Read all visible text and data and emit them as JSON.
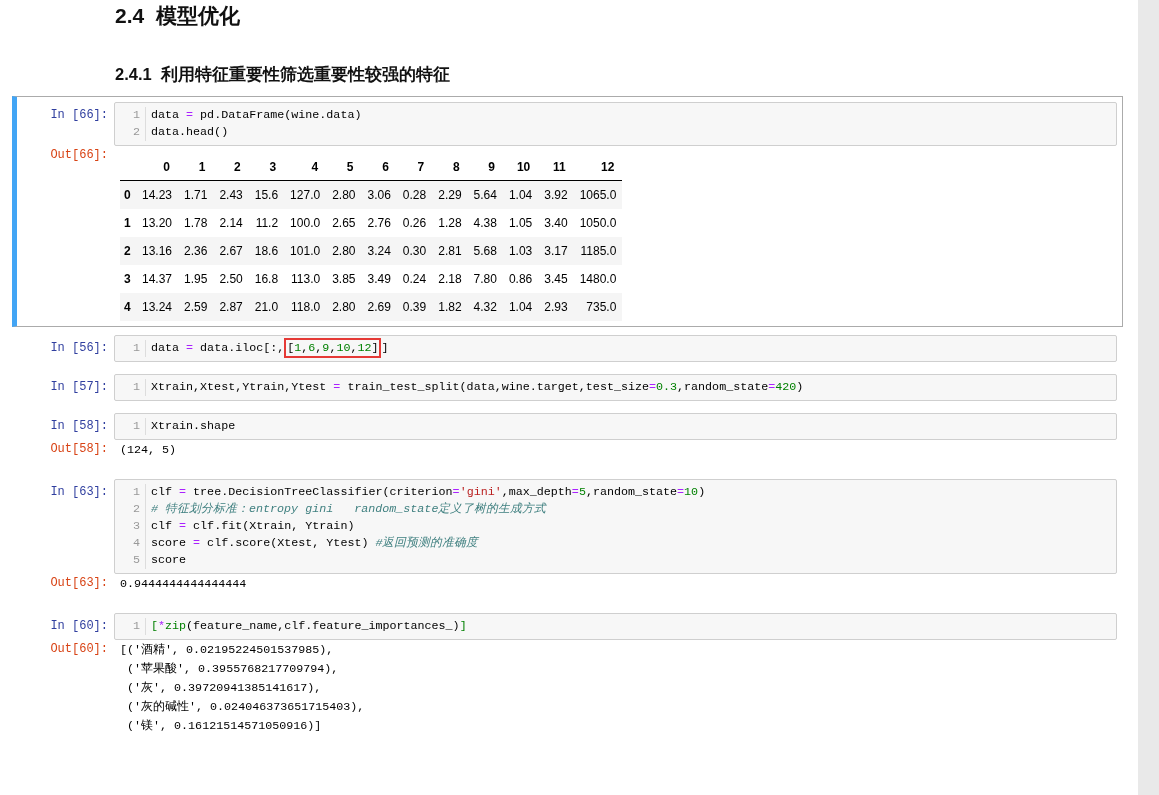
{
  "headings": [
    {
      "kind": "section",
      "number": "2.4",
      "text": "模型优化"
    },
    {
      "kind": "subsection",
      "number": "2.4.1",
      "text": "利用特征重要性筛选重要性较强的特征"
    }
  ],
  "cells": [
    {
      "selected": true,
      "prompt": "In [66]:",
      "lines": [
        {
          "number": "1",
          "tokens": [
            {
              "kind": "plain",
              "text": "data "
            },
            {
              "kind": "operator",
              "text": "="
            },
            {
              "kind": "plain",
              "text": " pd.DataFrame(wine.data)"
            }
          ]
        },
        {
          "number": "2",
          "tokens": [
            {
              "kind": "plain",
              "text": "data.head()"
            }
          ]
        }
      ],
      "output": {
        "prompt": "Out[66]:",
        "kind": "table",
        "columns": [
          "0",
          "1",
          "2",
          "3",
          "4",
          "5",
          "6",
          "7",
          "8",
          "9",
          "10",
          "11",
          "12"
        ],
        "rows": [
          {
            "index": "0",
            "cells": [
              "14.23",
              "1.71",
              "2.43",
              "15.6",
              "127.0",
              "2.80",
              "3.06",
              "0.28",
              "2.29",
              "5.64",
              "1.04",
              "3.92",
              "1065.0"
            ]
          },
          {
            "index": "1",
            "cells": [
              "13.20",
              "1.78",
              "2.14",
              "11.2",
              "100.0",
              "2.65",
              "2.76",
              "0.26",
              "1.28",
              "4.38",
              "1.05",
              "3.40",
              "1050.0"
            ]
          },
          {
            "index": "2",
            "cells": [
              "13.16",
              "2.36",
              "2.67",
              "18.6",
              "101.0",
              "2.80",
              "3.24",
              "0.30",
              "2.81",
              "5.68",
              "1.03",
              "3.17",
              "1185.0"
            ]
          },
          {
            "index": "3",
            "cells": [
              "14.37",
              "1.95",
              "2.50",
              "16.8",
              "113.0",
              "3.85",
              "3.49",
              "0.24",
              "2.18",
              "7.80",
              "0.86",
              "3.45",
              "1480.0"
            ]
          },
          {
            "index": "4",
            "cells": [
              "13.24",
              "2.59",
              "2.87",
              "21.0",
              "118.0",
              "2.80",
              "2.69",
              "0.39",
              "1.82",
              "4.32",
              "1.04",
              "2.93",
              "735.0"
            ]
          }
        ]
      }
    },
    {
      "selected": false,
      "prompt": "In [56]:",
      "lines": [
        {
          "number": "1",
          "tokens": [
            {
              "kind": "plain",
              "text": "data "
            },
            {
              "kind": "operator",
              "text": "="
            },
            {
              "kind": "plain",
              "text": " data.iloc[:,"
            },
            {
              "kind": "box",
              "tokens": [
                {
                  "kind": "plain",
                  "text": "["
                },
                {
                  "kind": "number",
                  "text": "1"
                },
                {
                  "kind": "plain",
                  "text": ","
                },
                {
                  "kind": "number",
                  "text": "6"
                },
                {
                  "kind": "plain",
                  "text": ","
                },
                {
                  "kind": "number",
                  "text": "9"
                },
                {
                  "kind": "plain",
                  "text": ","
                },
                {
                  "kind": "number",
                  "text": "10"
                },
                {
                  "kind": "plain",
                  "text": ","
                },
                {
                  "kind": "number",
                  "text": "12"
                },
                {
                  "kind": "plain",
                  "text": "]"
                }
              ]
            },
            {
              "kind": "plain",
              "text": "]"
            }
          ]
        }
      ]
    },
    {
      "selected": false,
      "prompt": "In [57]:",
      "lines": [
        {
          "number": "1",
          "tokens": [
            {
              "kind": "plain",
              "text": "Xtrain,Xtest,Ytrain,Ytest "
            },
            {
              "kind": "operator",
              "text": "="
            },
            {
              "kind": "plain",
              "text": " train_test_split(data,wine.target,test_size"
            },
            {
              "kind": "operator",
              "text": "="
            },
            {
              "kind": "number",
              "text": "0.3"
            },
            {
              "kind": "plain",
              "text": ",random_state"
            },
            {
              "kind": "operator",
              "text": "="
            },
            {
              "kind": "number",
              "text": "420"
            },
            {
              "kind": "plain",
              "text": ")"
            }
          ]
        }
      ]
    },
    {
      "selected": false,
      "prompt": "In [58]:",
      "lines": [
        {
          "number": "1",
          "tokens": [
            {
              "kind": "plain",
              "text": "Xtrain.shape"
            }
          ]
        }
      ],
      "output": {
        "prompt": "Out[58]:",
        "kind": "text",
        "lines": [
          "(124, 5)"
        ]
      }
    },
    {
      "selected": false,
      "prompt": "In [63]:",
      "lines": [
        {
          "number": "1",
          "tokens": [
            {
              "kind": "plain",
              "text": "clf "
            },
            {
              "kind": "operator",
              "text": "="
            },
            {
              "kind": "plain",
              "text": " tree.DecisionTreeClassifier(criterion"
            },
            {
              "kind": "operator",
              "text": "="
            },
            {
              "kind": "string",
              "text": "'gini'"
            },
            {
              "kind": "plain",
              "text": ",max_depth"
            },
            {
              "kind": "operator",
              "text": "="
            },
            {
              "kind": "number",
              "text": "5"
            },
            {
              "kind": "plain",
              "text": ",random_state"
            },
            {
              "kind": "operator",
              "text": "="
            },
            {
              "kind": "number",
              "text": "10"
            },
            {
              "kind": "plain",
              "text": ")"
            }
          ]
        },
        {
          "number": "2",
          "tokens": [
            {
              "kind": "comment",
              "text": "# 特征划分标准：entropy gini   random_state定义了树的生成方式"
            }
          ]
        },
        {
          "number": "3",
          "tokens": [
            {
              "kind": "plain",
              "text": "clf "
            },
            {
              "kind": "operator",
              "text": "="
            },
            {
              "kind": "plain",
              "text": " clf.fit(Xtrain, Ytrain)"
            }
          ]
        },
        {
          "number": "4",
          "tokens": [
            {
              "kind": "plain",
              "text": "score "
            },
            {
              "kind": "operator",
              "text": "="
            },
            {
              "kind": "plain",
              "text": " clf.score(Xtest, Ytest) "
            },
            {
              "kind": "comment",
              "text": "#返回预测的准确度"
            }
          ]
        },
        {
          "number": "5",
          "tokens": [
            {
              "kind": "plain",
              "text": "score"
            }
          ]
        }
      ],
      "output": {
        "prompt": "Out[63]:",
        "kind": "text",
        "lines": [
          "0.9444444444444444"
        ]
      }
    },
    {
      "selected": false,
      "prompt": "In [60]:",
      "lines": [
        {
          "number": "1",
          "tokens": [
            {
              "kind": "builtin",
              "text": "["
            },
            {
              "kind": "operator",
              "text": "*"
            },
            {
              "kind": "builtin",
              "text": "zip"
            },
            {
              "kind": "plain",
              "text": "(feature_name,clf.feature_importances_)"
            },
            {
              "kind": "builtin",
              "text": "]"
            }
          ]
        }
      ],
      "output": {
        "prompt": "Out[60]:",
        "kind": "text",
        "lines": [
          "[('酒精', 0.02195224501537985),",
          " ('苹果酸', 0.3955768217709794),",
          " ('灰', 0.39720941385141617),",
          " ('灰的碱性', 0.024046373651715403),",
          " ('镁', 0.16121514571050916)]"
        ]
      }
    }
  ]
}
